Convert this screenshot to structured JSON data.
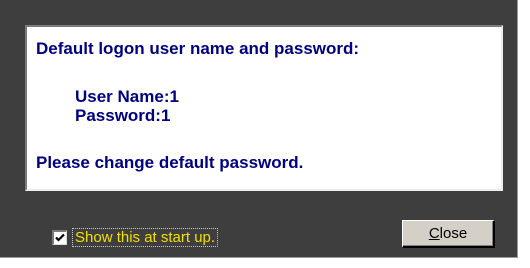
{
  "message": {
    "heading": "Default logon user name and password:",
    "username_line": "User Name:1",
    "password_line": "Password:1",
    "notice": "Please change default password."
  },
  "startup_option": {
    "label": "Show this at start up.",
    "checked": true
  },
  "close_button": {
    "mnemonic": "C",
    "label_rest": "lose"
  },
  "colors": {
    "dialog_background": "#3e3e3e",
    "message_text": "#000080",
    "checkbox_label": "#f2e000",
    "button_face": "#d4d0c8"
  }
}
